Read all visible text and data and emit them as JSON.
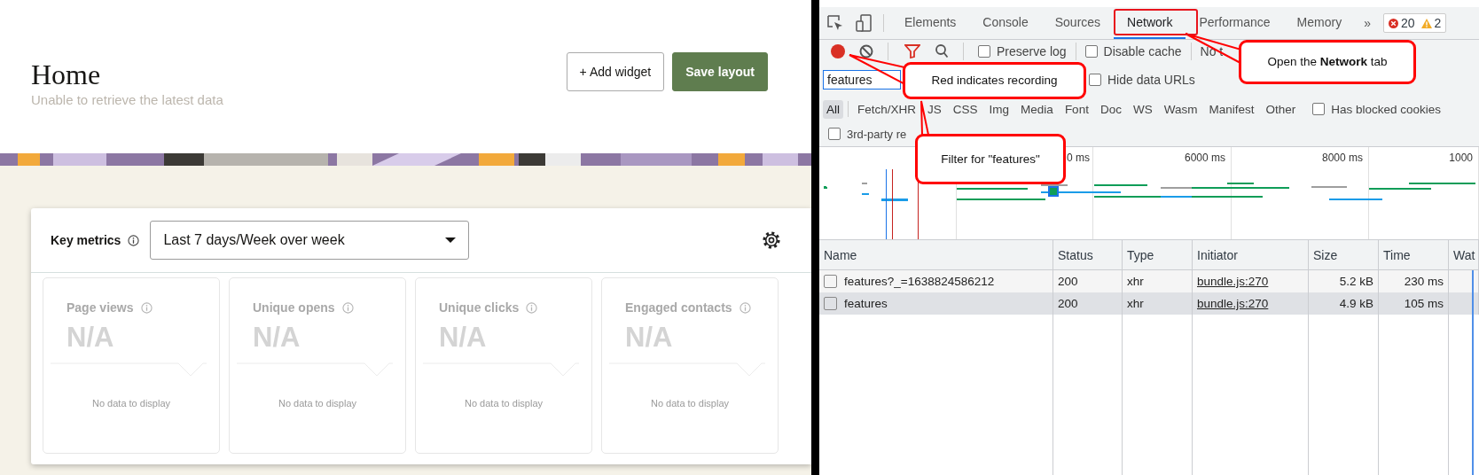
{
  "home": {
    "title": "Home",
    "subtitle": "Unable to retrieve the latest data",
    "buttons": [
      {
        "label": "+ Add widget",
        "kind": "secondary"
      },
      {
        "label": "Save layout",
        "kind": "primary"
      }
    ]
  },
  "key_metrics": {
    "title": "Key metrics",
    "period": "Last 7 days/Week over week",
    "tiles": [
      {
        "label": "Page views",
        "value": "N/A",
        "empty_text": "No data to display"
      },
      {
        "label": "Unique opens",
        "value": "N/A",
        "empty_text": "No data to display"
      },
      {
        "label": "Unique clicks",
        "value": "N/A",
        "empty_text": "No data to display"
      },
      {
        "label": "Engaged contacts",
        "value": "N/A",
        "empty_text": "No data to display"
      }
    ]
  },
  "devtools": {
    "tabs": [
      {
        "label": "Elements",
        "selected": false
      },
      {
        "label": "Console",
        "selected": false
      },
      {
        "label": "Sources",
        "selected": false
      },
      {
        "label": "Network",
        "selected": true
      },
      {
        "label": "Performance",
        "selected": false
      },
      {
        "label": "Memory",
        "selected": false
      }
    ],
    "more_tabs": "»",
    "errors": "20",
    "warnings": "2",
    "toolbar": {
      "recording": true,
      "checkboxes": [
        {
          "label": "Preserve log",
          "checked": false
        },
        {
          "label": "Disable cache",
          "checked": false
        }
      ],
      "throttling": "No t"
    },
    "filter": {
      "value": "features",
      "hide_data_urls": {
        "label": "Hide data URLs",
        "checked": false
      }
    },
    "type_filters": [
      {
        "label": "All",
        "selected": true
      },
      {
        "label": "Fetch/XHR",
        "selected": false
      },
      {
        "label": "JS",
        "selected": false
      },
      {
        "label": "CSS",
        "selected": false
      },
      {
        "label": "Img",
        "selected": false
      },
      {
        "label": "Media",
        "selected": false
      },
      {
        "label": "Font",
        "selected": false
      },
      {
        "label": "Doc",
        "selected": false
      },
      {
        "label": "WS",
        "selected": false
      },
      {
        "label": "Wasm",
        "selected": false
      },
      {
        "label": "Manifest",
        "selected": false
      },
      {
        "label": "Other",
        "selected": false
      }
    ],
    "has_blocked_cookies": {
      "label": "Has blocked cookies",
      "checked": false
    },
    "third_party": {
      "label": "3rd-party re",
      "checked": false
    },
    "timeline": {
      "ticks": [
        "0 ms",
        "6000 ms",
        "8000 ms",
        "1000"
      ]
    },
    "table": {
      "columns": [
        "Name",
        "Status",
        "Type",
        "Initiator",
        "Size",
        "Time",
        "Wat"
      ],
      "rows": [
        {
          "cells": [
            "features?_=1638824586212",
            "200",
            "xhr",
            "bundle.js:270",
            "5.2 kB",
            "230 ms"
          ],
          "selected": false
        },
        {
          "cells": [
            "features",
            "200",
            "xhr",
            "bundle.js:270",
            "4.9 kB",
            "105 ms"
          ],
          "selected": true
        }
      ]
    }
  },
  "annotations": [
    {
      "kind": "highlight"
    },
    {
      "kind": "callout",
      "text": "Open the **Network** tab"
    },
    {
      "kind": "callout",
      "text": "Red indicates recording"
    },
    {
      "kind": "callout",
      "text": "Filter for \"features\""
    }
  ]
}
